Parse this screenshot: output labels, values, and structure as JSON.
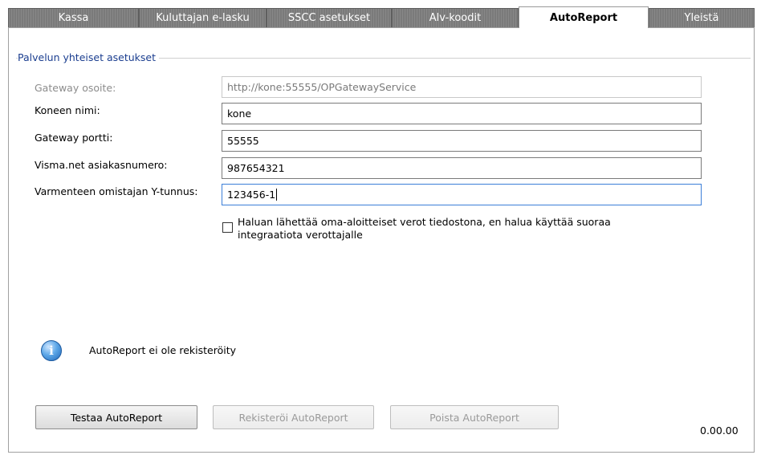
{
  "tabs": [
    {
      "label": "Kassa",
      "active": false
    },
    {
      "label": "Kuluttajan e-lasku",
      "active": false
    },
    {
      "label": "SSCC asetukset",
      "active": false
    },
    {
      "label": "Alv-koodit",
      "active": false
    },
    {
      "label": "AutoReport",
      "active": true
    },
    {
      "label": "Yleistä",
      "active": false
    }
  ],
  "group": {
    "title": "Palvelun yhteiset asetukset"
  },
  "fields": {
    "gateway_address": {
      "label": "Gateway osoite:",
      "value": "http://kone:55555/OPGatewayService",
      "disabled": true
    },
    "machine_name": {
      "label": "Koneen nimi:",
      "value": "kone"
    },
    "gateway_port": {
      "label": "Gateway portti:",
      "value": "55555"
    },
    "customer_number": {
      "label": "Visma.net asiakasnumero:",
      "value": "987654321"
    },
    "business_id": {
      "label": "Varmenteen omistajan Y-tunnus:",
      "value": "123456-1",
      "focused": true
    }
  },
  "checkbox": {
    "checked": false,
    "line1": "Haluan lähettää oma-aloitteiset verot tiedostona, en halua käyttää suoraa",
    "line2": "integraatiota verottajalle"
  },
  "info": {
    "icon": "info-icon",
    "text": "AutoReport ei ole rekisteröity"
  },
  "buttons": {
    "test": "Testaa AutoReport",
    "register": "Rekisteröi AutoReport",
    "remove": "Poista AutoReport"
  },
  "version": "0.00.00",
  "colors": {
    "group_title": "#1a3d8f",
    "focus_border": "#3c7fd8",
    "inactive_tab": "#7a7a7a"
  }
}
